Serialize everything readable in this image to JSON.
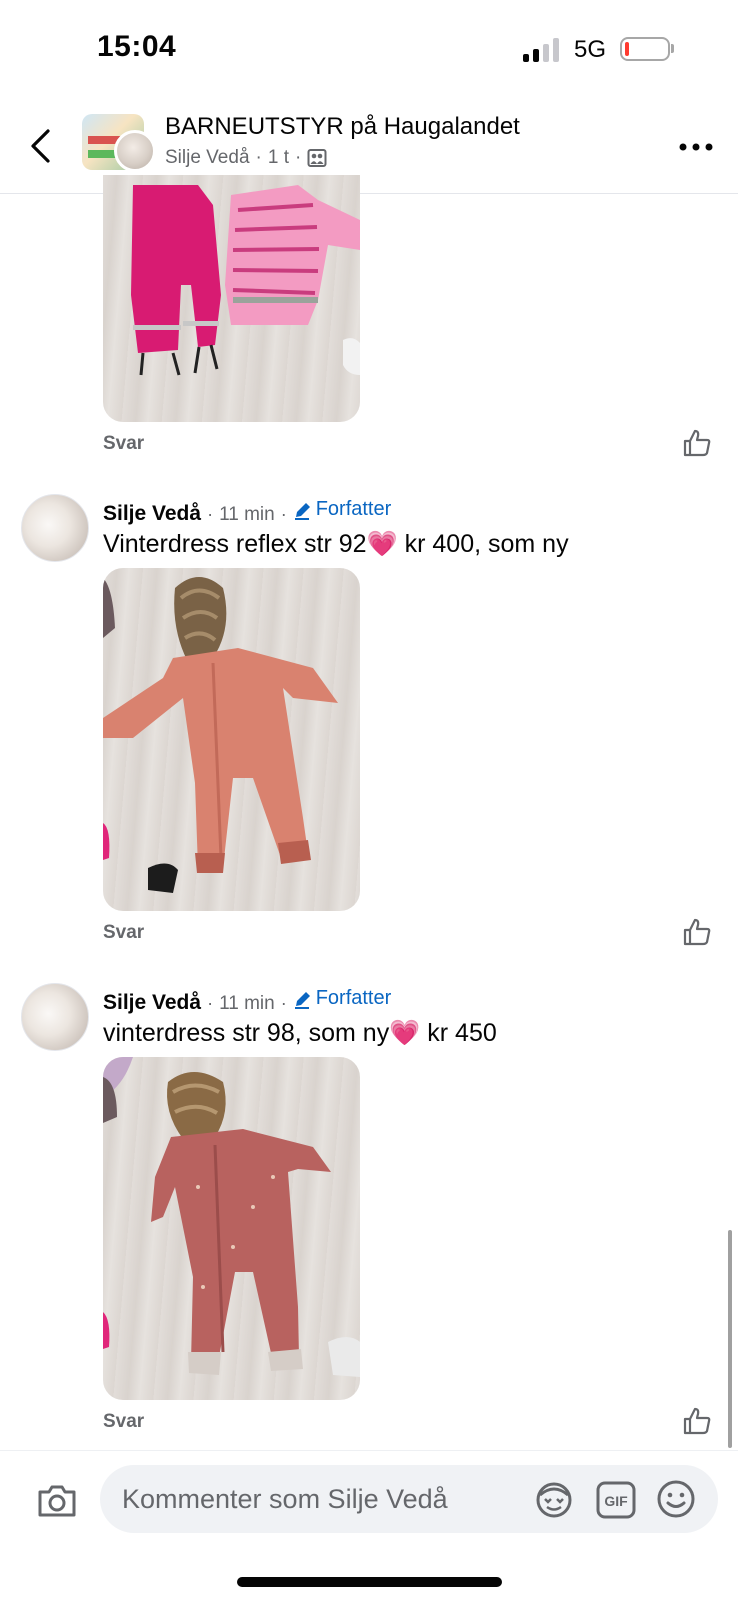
{
  "status_bar": {
    "time": "15:04",
    "network": "5G",
    "battery_low_color": "#ff3b30"
  },
  "header": {
    "group_title": "BARNEUTSTYR på Haugalandet",
    "poster_name": "Silje Vedå",
    "separator": "·",
    "post_age": "1 t",
    "audience_icon": "members-icon"
  },
  "comments": [
    {
      "reply_label": "Svar"
    },
    {
      "author": "Silje Vedå",
      "time": "11 min",
      "role": "Forfatter",
      "text": "Vinterdress reflex str 92💗 kr 400, som ny",
      "reply_label": "Svar"
    },
    {
      "author": "Silje Vedå",
      "time": "11 min",
      "role": "Forfatter",
      "text": "vinterdress str 98, som ny💗 kr 450",
      "reply_label": "Svar"
    }
  ],
  "composer": {
    "placeholder": "Kommenter som Silje Vedå",
    "gif_label": "GIF"
  },
  "colors": {
    "accent_blue": "#0a66c2",
    "secondary_text": "#65676b",
    "input_bg": "#f0f2f5"
  }
}
